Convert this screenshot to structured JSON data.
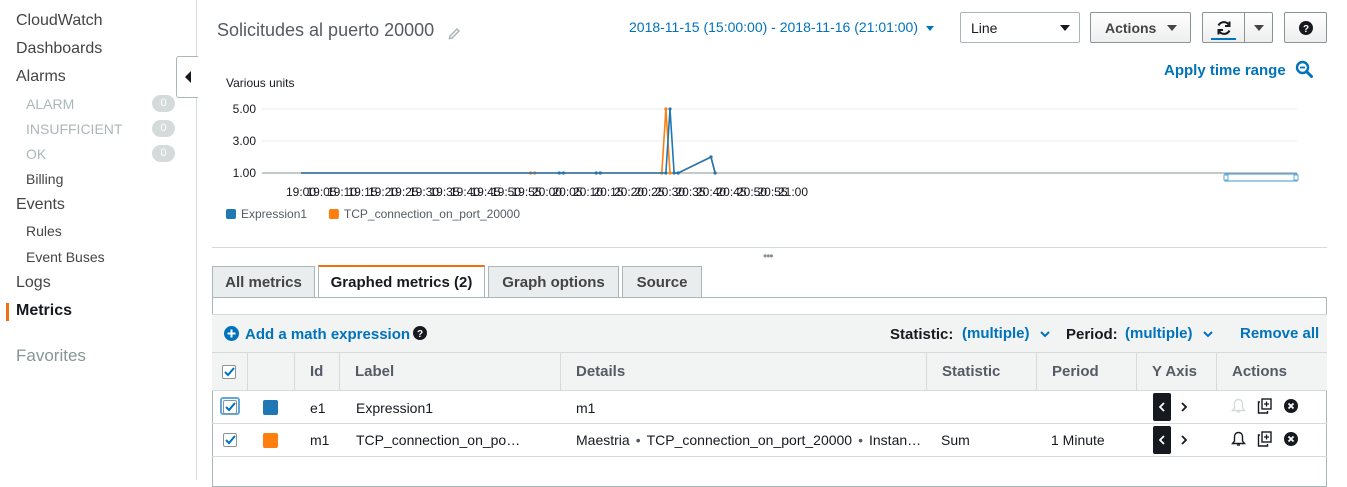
{
  "sidebar": {
    "cloudwatch": "CloudWatch",
    "dashboards": "Dashboards",
    "alarms": "Alarms",
    "alarm": "ALARM",
    "alarm_count": "0",
    "insufficient": "INSUFFICIENT",
    "insufficient_count": "0",
    "ok": "OK",
    "ok_count": "0",
    "billing": "Billing",
    "events": "Events",
    "rules": "Rules",
    "event_buses": "Event Buses",
    "logs": "Logs",
    "metrics": "Metrics",
    "favorites": "Favorites"
  },
  "header": {
    "title": "Solicitudes al puerto 20000",
    "time_range": "2018-11-15 (15:00:00) - 2018-11-16 (21:01:00)",
    "view_type": "Line",
    "actions_label": "Actions"
  },
  "chart_header": {
    "apply_time_range": "Apply time range"
  },
  "chart_data": {
    "type": "line",
    "ylabel": "Various units",
    "y_ticks": [
      "1.00",
      "3.00",
      "5.00"
    ],
    "ylim": [
      1,
      5
    ],
    "x_tick_labels": [
      "19:00",
      "19:05",
      "19:10",
      "19:15",
      "19:20",
      "19:25",
      "19:30",
      "19:35",
      "19:40",
      "19:45",
      "19:50",
      "19:55",
      "20:00",
      "20:05",
      "20:10",
      "20:15",
      "20:20",
      "20:25",
      "20:30",
      "20:35",
      "20:40",
      "20:45",
      "20:50",
      "20:55",
      "21:00"
    ],
    "x_unit": "minutes after 19:00",
    "series": [
      {
        "name": "Expression1",
        "color": "#1f77b4",
        "points": [
          [
            0,
            1
          ],
          [
            63,
            1
          ],
          [
            64,
            1
          ],
          [
            72,
            1
          ],
          [
            73,
            1
          ],
          [
            89,
            1
          ],
          [
            90,
            5
          ],
          [
            91,
            1
          ],
          [
            92,
            1
          ],
          [
            100,
            2
          ],
          [
            101,
            1
          ]
        ]
      },
      {
        "name": "TCP_connection_on_port_20000",
        "color": "#ff7f0e",
        "points": [
          [
            0,
            1
          ],
          [
            56,
            1
          ],
          [
            57,
            1
          ],
          [
            72,
            1
          ],
          [
            73,
            1
          ],
          [
            88,
            1
          ],
          [
            89,
            5
          ],
          [
            90,
            1
          ],
          [
            92,
            1
          ],
          [
            100,
            2
          ],
          [
            101,
            1
          ]
        ]
      }
    ],
    "grid": "horizontal",
    "legend": "bottom-left"
  },
  "tabs": [
    {
      "label": "All metrics"
    },
    {
      "label": "Graphed metrics (2)"
    },
    {
      "label": "Graph options"
    },
    {
      "label": "Source"
    }
  ],
  "toolbar": {
    "add_math": "Add a math expression",
    "statistic_label": "Statistic:",
    "statistic_value": "(multiple)",
    "period_label": "Period:",
    "period_value": "(multiple)",
    "remove_all": "Remove all"
  },
  "table": {
    "headers": [
      "Id",
      "Label",
      "Details",
      "Statistic",
      "Period",
      "Y Axis",
      "Actions"
    ],
    "rows": [
      {
        "id": "e1",
        "label": "Expression1",
        "details": "m1",
        "details_parts": [],
        "statistic": "",
        "period": "",
        "color": "#1f77b4"
      },
      {
        "id": "m1",
        "label": "TCP_connection_on_po…",
        "details": "",
        "details_parts": [
          "Maestria",
          "TCP_connection_on_port_20000",
          "Instan…"
        ],
        "statistic": "Sum",
        "period": "1 Minute",
        "color": "#ff7f0e"
      }
    ]
  }
}
